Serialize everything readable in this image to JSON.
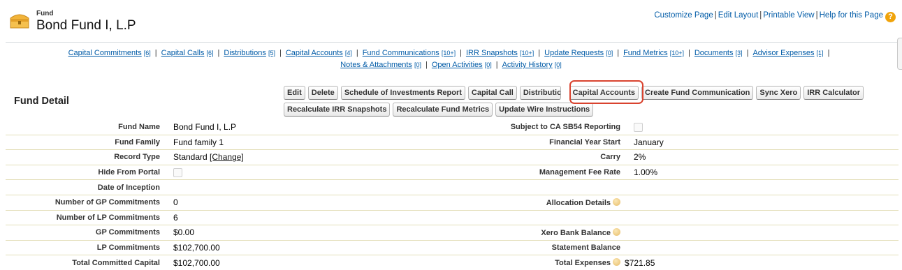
{
  "header": {
    "object_type": "Fund",
    "record_name": "Bond Fund I, L.P",
    "links": [
      "Customize Page",
      "Edit Layout",
      "Printable View",
      "Help for this Page"
    ],
    "help_icon": "question-mark-icon",
    "fund_icon": "treasure-chest-icon"
  },
  "related_links": [
    {
      "label": "Capital Commitments",
      "count": "[6]"
    },
    {
      "label": "Capital Calls",
      "count": "[6]"
    },
    {
      "label": "Distributions",
      "count": "[5]"
    },
    {
      "label": "Capital Accounts",
      "count": "[4]"
    },
    {
      "label": "Fund Communications",
      "count": "[10+]"
    },
    {
      "label": "IRR Snapshots",
      "count": "[10+]"
    },
    {
      "label": "Update Requests",
      "count": "[0]"
    },
    {
      "label": "Fund Metrics",
      "count": "[10+]"
    },
    {
      "label": "Documents",
      "count": "[3]"
    },
    {
      "label": "Advisor Expenses",
      "count": "[1]"
    },
    {
      "label": "Notes & Attachments",
      "count": "[0]"
    },
    {
      "label": "Open Activities",
      "count": "[0]"
    },
    {
      "label": "Activity History",
      "count": "[0]"
    }
  ],
  "section": {
    "title": "Fund Detail"
  },
  "buttons": {
    "row1": [
      "Edit",
      "Delete",
      "Schedule of Investments Report",
      "Capital Call",
      "Distributions",
      "Capital Accounts",
      "Create Fund Communication",
      "Sync Xero",
      "IRR Calculator"
    ],
    "row2": [
      "Recalculate IRR Snapshots",
      "Recalculate Fund Metrics",
      "Update Wire Instructions"
    ]
  },
  "highlight_color": "#d9432f",
  "fields_left": [
    {
      "label": "Fund Name",
      "value": "Bond Fund I, L.P"
    },
    {
      "label": "Fund Family",
      "value": "Fund family 1"
    },
    {
      "label": "Record Type",
      "value": "Standard",
      "link": "[Change]"
    },
    {
      "label": "Hide From Portal",
      "value": "",
      "checkbox": true
    },
    {
      "label": "Date of Inception",
      "value": ""
    },
    {
      "label": "Number of GP Commitments",
      "value": "0"
    },
    {
      "label": "Number of LP Commitments",
      "value": "6"
    },
    {
      "label": "GP Commitments",
      "value": "$0.00"
    },
    {
      "label": "LP Commitments",
      "value": "$102,700.00"
    },
    {
      "label": "Total Committed Capital",
      "value": "$102,700.00"
    }
  ],
  "fields_right": [
    {
      "label": "Subject to CA SB54 Reporting",
      "value": "",
      "checkbox": true
    },
    {
      "label": "Financial Year Start",
      "value": "January"
    },
    {
      "label": "Carry",
      "value": "2%"
    },
    {
      "label": "Management Fee Rate",
      "value": "1.00%"
    },
    {
      "label": "",
      "value": ""
    },
    {
      "label": "Allocation Details",
      "value": "",
      "info": true
    },
    {
      "label": "",
      "value": ""
    },
    {
      "label": "Xero Bank Balance",
      "value": "",
      "info": true
    },
    {
      "label": "Statement Balance",
      "value": ""
    },
    {
      "label": "Total Expenses",
      "value": "$721.85",
      "info": true
    }
  ]
}
